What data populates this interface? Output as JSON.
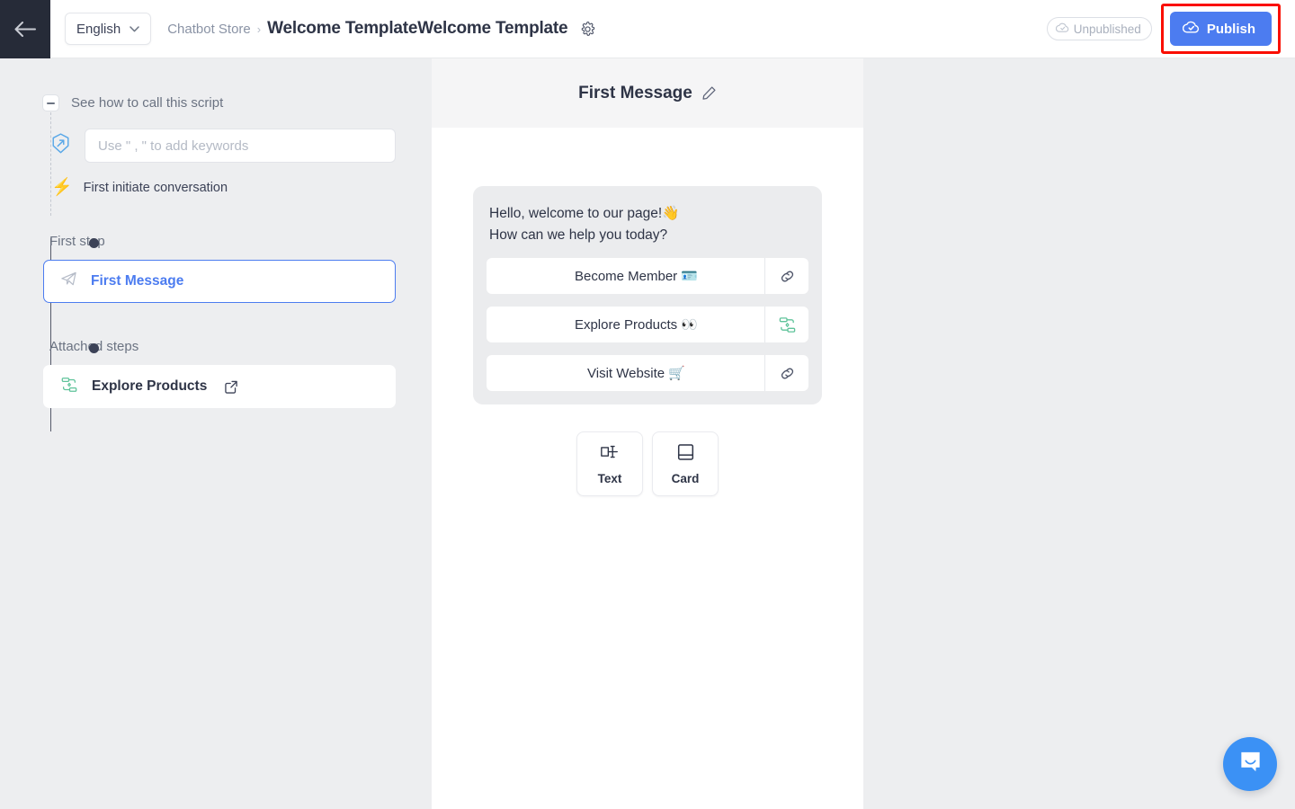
{
  "header": {
    "back_icon": "arrow-left-icon",
    "language": {
      "label": "English",
      "chevron": "chevron-down-icon"
    },
    "breadcrumb": {
      "parent": "Chatbot Store",
      "separator": "›",
      "title": "Welcome TemplateWelcome Template",
      "gear_icon": "gear-icon"
    },
    "status_badge": {
      "label": "Unpublished",
      "icon": "cloud-icon"
    },
    "publish": {
      "label": "Publish",
      "icon": "cloud-check-icon",
      "color": "#4c7cf0",
      "highlight_color": "#fa0e00"
    }
  },
  "sidebar": {
    "collapse": {
      "label": "See how to call this script",
      "icon": "minus-icon"
    },
    "keywords": {
      "placeholder": "Use \" , \" to add keywords",
      "value": "",
      "icon": "tag-arrow-icon"
    },
    "trigger": {
      "icon": "⚡",
      "label": "First initiate conversation"
    },
    "first_step": {
      "label": "First step",
      "item": {
        "name": "First Message",
        "icon": "paper-plane-icon",
        "selected": true
      }
    },
    "attached_steps": {
      "label": "Attached steps",
      "items": [
        {
          "name": "Explore Products",
          "icon": "flow-icon",
          "link_icon": "external-link-icon"
        }
      ]
    }
  },
  "center": {
    "title": "First Message",
    "edit_icon": "pencil-icon",
    "bubble": {
      "text_line_1": "Hello, welcome to our page!👋",
      "text_line_2": "How can we help you today?",
      "buttons": [
        {
          "label": "Become Member 🪪",
          "action_icon": "link-icon"
        },
        {
          "label": "Explore Products 👀",
          "action_icon": "flow-icon"
        },
        {
          "label": "Visit Website 🛒",
          "action_icon": "link-icon"
        }
      ]
    },
    "add_blocks": [
      {
        "label": "Text",
        "icon": "text-block-icon"
      },
      {
        "label": "Card",
        "icon": "card-block-icon"
      }
    ]
  },
  "messenger": {
    "icon": "messenger-chat-icon",
    "color": "#3b91f5"
  }
}
